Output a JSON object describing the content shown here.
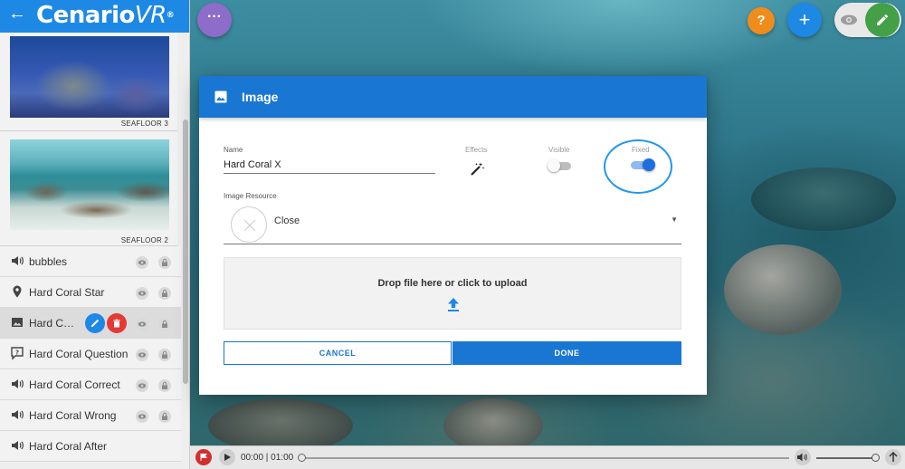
{
  "app": {
    "brand_main": "Cenario",
    "brand_vr": "VR",
    "brand_mark": "®"
  },
  "scenes": [
    {
      "label": "SEAFLOOR 3"
    },
    {
      "label": "SEAFLOOR 2"
    }
  ],
  "layers": [
    {
      "label": "bubbles",
      "icon": "audio-icon"
    },
    {
      "label": "Hard Coral Star",
      "icon": "location-pin-icon"
    },
    {
      "label": "Hard Coral X",
      "icon": "image-icon",
      "selected": true
    },
    {
      "label": "Hard Coral Question",
      "icon": "question-box-icon"
    },
    {
      "label": "Hard Coral Correct",
      "icon": "audio-icon"
    },
    {
      "label": "Hard Coral Wrong",
      "icon": "audio-icon"
    },
    {
      "label": "Hard Coral After",
      "icon": "audio-icon"
    }
  ],
  "toolbar": {
    "menu_glyph": "···",
    "help_glyph": "?",
    "add_glyph": "+"
  },
  "dialog": {
    "title": "Image",
    "name_label": "Name",
    "name_value": "Hard Coral X",
    "effects_label": "Effects",
    "visible_label": "Visible",
    "visible_on": false,
    "fixed_label": "Fixed",
    "fixed_on": true,
    "resource_label": "Image Resource",
    "resource_value": "Close",
    "dropzone_text": "Drop file here or click to upload",
    "cancel_label": "CANCEL",
    "done_label": "DONE"
  },
  "player": {
    "time": "00:00 | 01:00",
    "progress": 0.0,
    "volume": 1.0
  },
  "colors": {
    "primary": "#1976d2",
    "accent_green": "#43a047",
    "help_orange": "#ef8c1c",
    "menu_purple": "#8e6cc9",
    "delete_red": "#e53935"
  }
}
